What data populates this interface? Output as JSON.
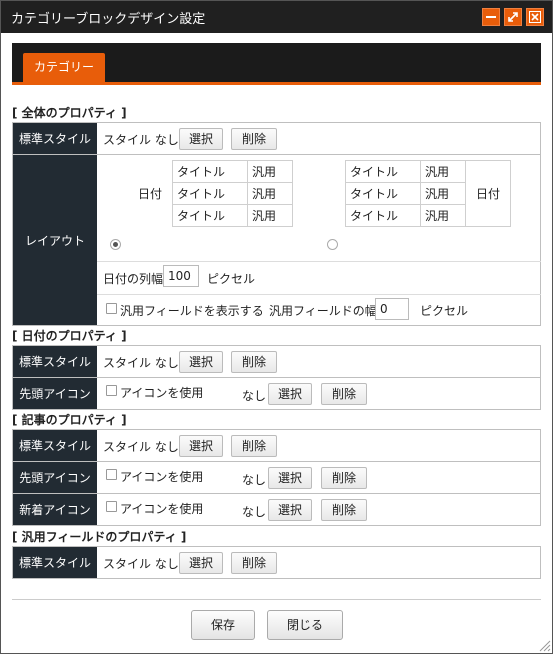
{
  "window": {
    "title": "カテゴリーブロックデザイン設定"
  },
  "tabs": [
    {
      "label": "カテゴリー"
    }
  ],
  "sections": {
    "overall": "[ 全体のプロパティ ]",
    "date": "[ 日付のプロパティ ]",
    "article": "[ 記事のプロパティ ]",
    "general": "[ 汎用フィールドのプロパティ ]"
  },
  "labels": {
    "standard_style": "標準スタイル",
    "layout": "レイアウト",
    "lead_icon": "先頭アイコン",
    "new_icon": "新着アイコン"
  },
  "common": {
    "style_none": "スタイル なし",
    "select": "選択",
    "delete": "削除",
    "use_icon": "アイコンを使用",
    "none": "なし",
    "pixel": "ピクセル"
  },
  "layout": {
    "date": "日付",
    "title": "タイトル",
    "general": "汎用",
    "date_col_width_label": "日付の列幅",
    "date_col_width_value": "100",
    "show_general_label": "汎用フィールドを表示する",
    "general_width_label": "汎用フィールドの幅",
    "general_width_value": "0",
    "selected_option": 1
  },
  "footer": {
    "save": "保存",
    "close": "閉じる"
  }
}
